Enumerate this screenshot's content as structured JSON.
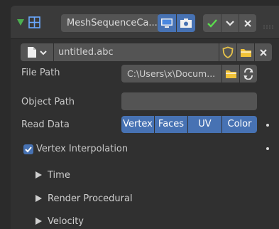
{
  "modifier": {
    "name": "MeshSequenceCa...",
    "colors": {
      "expand": "#4caf50",
      "check": "#5bdb4d"
    }
  },
  "cache": {
    "file_name": "untitled.abc"
  },
  "properties": {
    "file_path_label": "File Path",
    "file_path_value": "C:\\Users\\x\\Docum...",
    "object_path_label": "Object Path",
    "object_path_value": "",
    "read_data_label": "Read Data",
    "read_data_options": [
      "Vertex",
      "Faces",
      "UV",
      "Color"
    ],
    "vertex_interpolation_label": "Vertex Interpolation",
    "vertex_interpolation_checked": true
  },
  "subpanels": [
    "Time",
    "Render Procedural",
    "Velocity"
  ],
  "accent": "#4772b3"
}
